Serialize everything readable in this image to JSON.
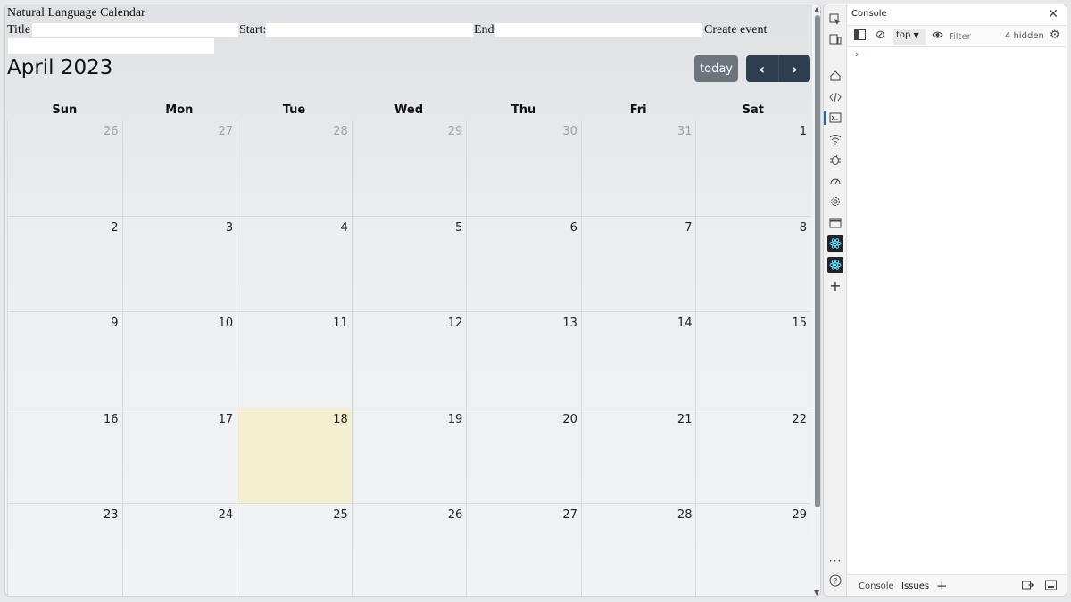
{
  "app": {
    "title": "Natural Language Calendar",
    "form": {
      "title_label": "Title:",
      "start_label": "Start:",
      "end_label": "End:",
      "title_value": "",
      "start_value": "",
      "end_value": "",
      "create_label": "Create event"
    }
  },
  "calendar": {
    "month_title": "April 2023",
    "today_label": "today",
    "prev_icon": "chevron-left-icon",
    "next_icon": "chevron-right-icon",
    "weekdays": [
      "Sun",
      "Mon",
      "Tue",
      "Wed",
      "Thu",
      "Fri",
      "Sat"
    ],
    "weeks": [
      [
        {
          "d": "26",
          "other": true
        },
        {
          "d": "27",
          "other": true
        },
        {
          "d": "28",
          "other": true
        },
        {
          "d": "29",
          "other": true
        },
        {
          "d": "30",
          "other": true
        },
        {
          "d": "31",
          "other": true
        },
        {
          "d": "1"
        }
      ],
      [
        {
          "d": "2"
        },
        {
          "d": "3"
        },
        {
          "d": "4"
        },
        {
          "d": "5"
        },
        {
          "d": "6"
        },
        {
          "d": "7"
        },
        {
          "d": "8"
        }
      ],
      [
        {
          "d": "9"
        },
        {
          "d": "10"
        },
        {
          "d": "11"
        },
        {
          "d": "12"
        },
        {
          "d": "13"
        },
        {
          "d": "14"
        },
        {
          "d": "15"
        }
      ],
      [
        {
          "d": "16"
        },
        {
          "d": "17"
        },
        {
          "d": "18",
          "today": true
        },
        {
          "d": "19"
        },
        {
          "d": "20"
        },
        {
          "d": "21"
        },
        {
          "d": "22"
        }
      ],
      [
        {
          "d": "23"
        },
        {
          "d": "24"
        },
        {
          "d": "25"
        },
        {
          "d": "26"
        },
        {
          "d": "27"
        },
        {
          "d": "28"
        },
        {
          "d": "29"
        }
      ]
    ],
    "today_color": "#f5efd2",
    "nav_color": "#2c3e50",
    "today_button_color": "#6c757d"
  },
  "devtools": {
    "panel_title": "Console",
    "context": "top",
    "filter_placeholder": "Filter",
    "hidden_count": "4 hidden",
    "prompt_symbol": "›",
    "drawer_tabs": [
      "Console",
      "Issues"
    ],
    "activity_icons": [
      "inspect-icon",
      "device-emulation-icon",
      "welcome-home-icon",
      "elements-icon",
      "console-icon",
      "network-icon",
      "sources-icon",
      "performance-icon",
      "settings-icon",
      "application-icon",
      "react-components-icon",
      "react-profiler-icon",
      "more-tools-icon",
      "more-icon",
      "help-icon"
    ]
  }
}
